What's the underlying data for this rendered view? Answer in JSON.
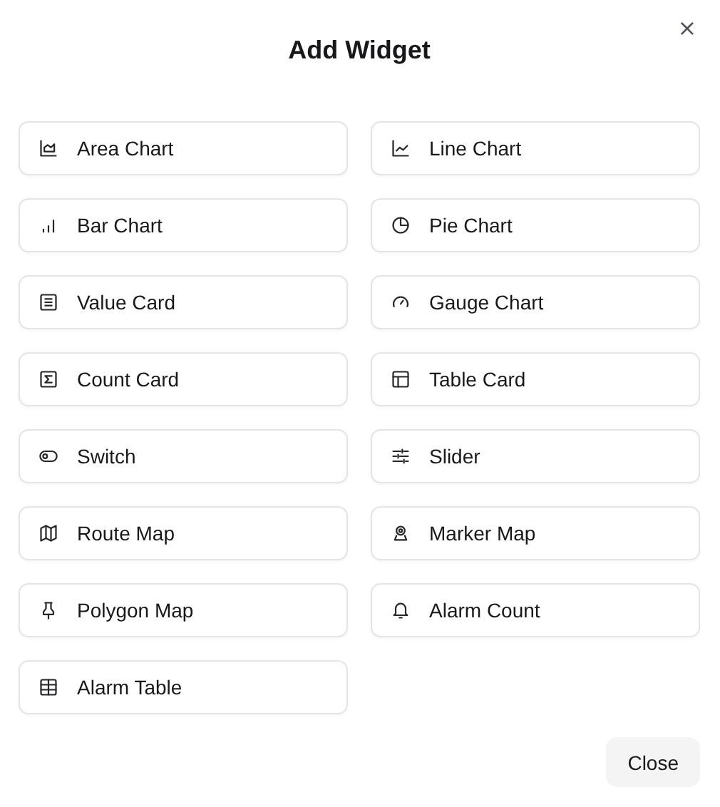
{
  "dialog": {
    "title": "Add Widget",
    "close_icon": "×"
  },
  "widgets": [
    {
      "label": "Area Chart"
    },
    {
      "label": "Line Chart"
    },
    {
      "label": "Bar Chart"
    },
    {
      "label": "Pie Chart"
    },
    {
      "label": "Value Card"
    },
    {
      "label": "Gauge Chart"
    },
    {
      "label": "Count Card"
    },
    {
      "label": "Table Card"
    },
    {
      "label": "Switch"
    },
    {
      "label": "Slider"
    },
    {
      "label": "Route Map"
    },
    {
      "label": "Marker Map"
    },
    {
      "label": "Polygon Map"
    },
    {
      "label": "Alarm Count"
    },
    {
      "label": "Alarm Table"
    }
  ],
  "footer": {
    "close_button": "Close"
  }
}
